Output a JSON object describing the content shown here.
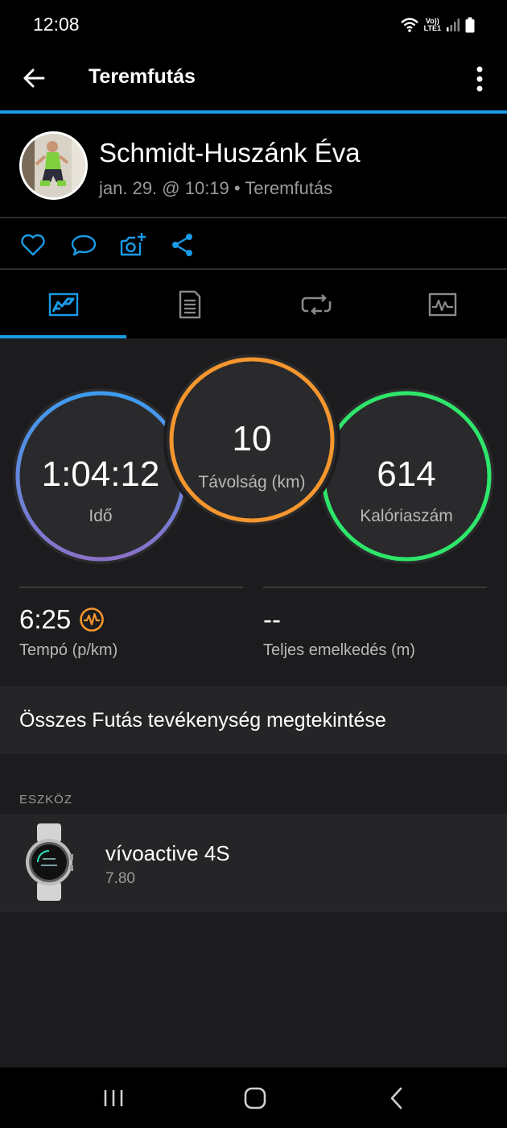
{
  "status_bar": {
    "time": "12:08",
    "network_label_top": "Vo))",
    "network_label_bottom": "LTE1"
  },
  "app_bar": {
    "title": "Teremfutás",
    "back_icon": "arrow-left-icon",
    "menu_icon": "more-vertical-icon"
  },
  "profile": {
    "name": "Schmidt-Huszánk Éva",
    "subtitle": "jan. 29. @ 10:19 • Teremfutás"
  },
  "actions": [
    {
      "icon": "heart-icon"
    },
    {
      "icon": "comment-icon"
    },
    {
      "icon": "add-photo-icon"
    },
    {
      "icon": "share-icon"
    }
  ],
  "tabs": [
    {
      "icon": "summary-icon",
      "active": true
    },
    {
      "icon": "details-icon",
      "active": false
    },
    {
      "icon": "laps-icon",
      "active": false
    },
    {
      "icon": "charts-icon",
      "active": false
    }
  ],
  "stats": {
    "time": {
      "value": "1:04:12",
      "label": "Idő"
    },
    "distance": {
      "value": "10",
      "label": "Távolság (km)"
    },
    "calories": {
      "value": "614",
      "label": "Kalóriaszám"
    },
    "pace": {
      "value": "6:25",
      "label": "Tempó (p/km)"
    },
    "elevation": {
      "value": "--",
      "label": "Teljes emelkedés (m)"
    }
  },
  "all_activities_link": "Összes Futás tevékenység megtekintése",
  "device_section": {
    "header": "ESZKÖZ",
    "name": "vívoactive 4S",
    "version": "7.80"
  },
  "colors": {
    "accent": "#1a9be6",
    "time_ring_start": "#3d9cf0",
    "time_ring_end": "#8a72c8",
    "distance_ring": "#f5962e",
    "calories_ring": "#2ee66a",
    "pace_badge": "#f5962e"
  }
}
